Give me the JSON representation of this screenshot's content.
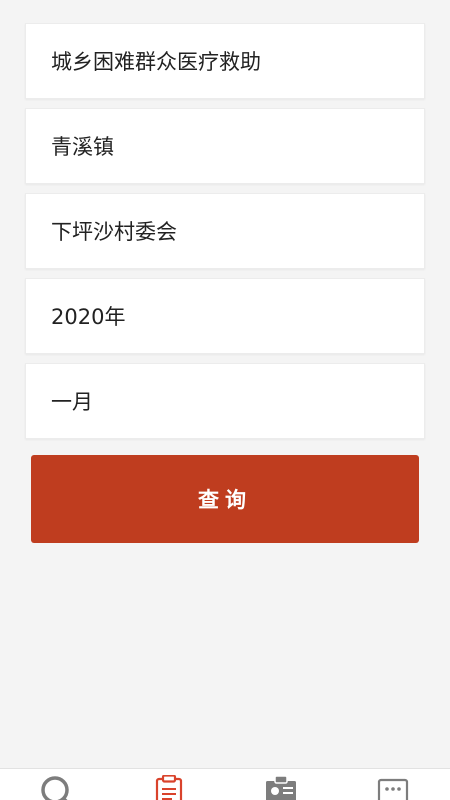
{
  "form": {
    "assistance_type": "城乡困难群众医疗救助",
    "town": "青溪镇",
    "village": "下坪沙村委会",
    "year": "2020年",
    "month": "一月"
  },
  "query_button_label": "查询",
  "tabbar": {
    "tabs": [
      {
        "icon": "search-icon",
        "active": false
      },
      {
        "icon": "clipboard-icon",
        "active": true
      },
      {
        "icon": "id-card-icon",
        "active": false
      },
      {
        "icon": "message-icon",
        "active": false
      }
    ]
  },
  "colors": {
    "accent": "#bf3d1f",
    "background": "#f4f4f4",
    "icon_inactive": "#7d7d7d",
    "icon_active": "#d9432c"
  }
}
